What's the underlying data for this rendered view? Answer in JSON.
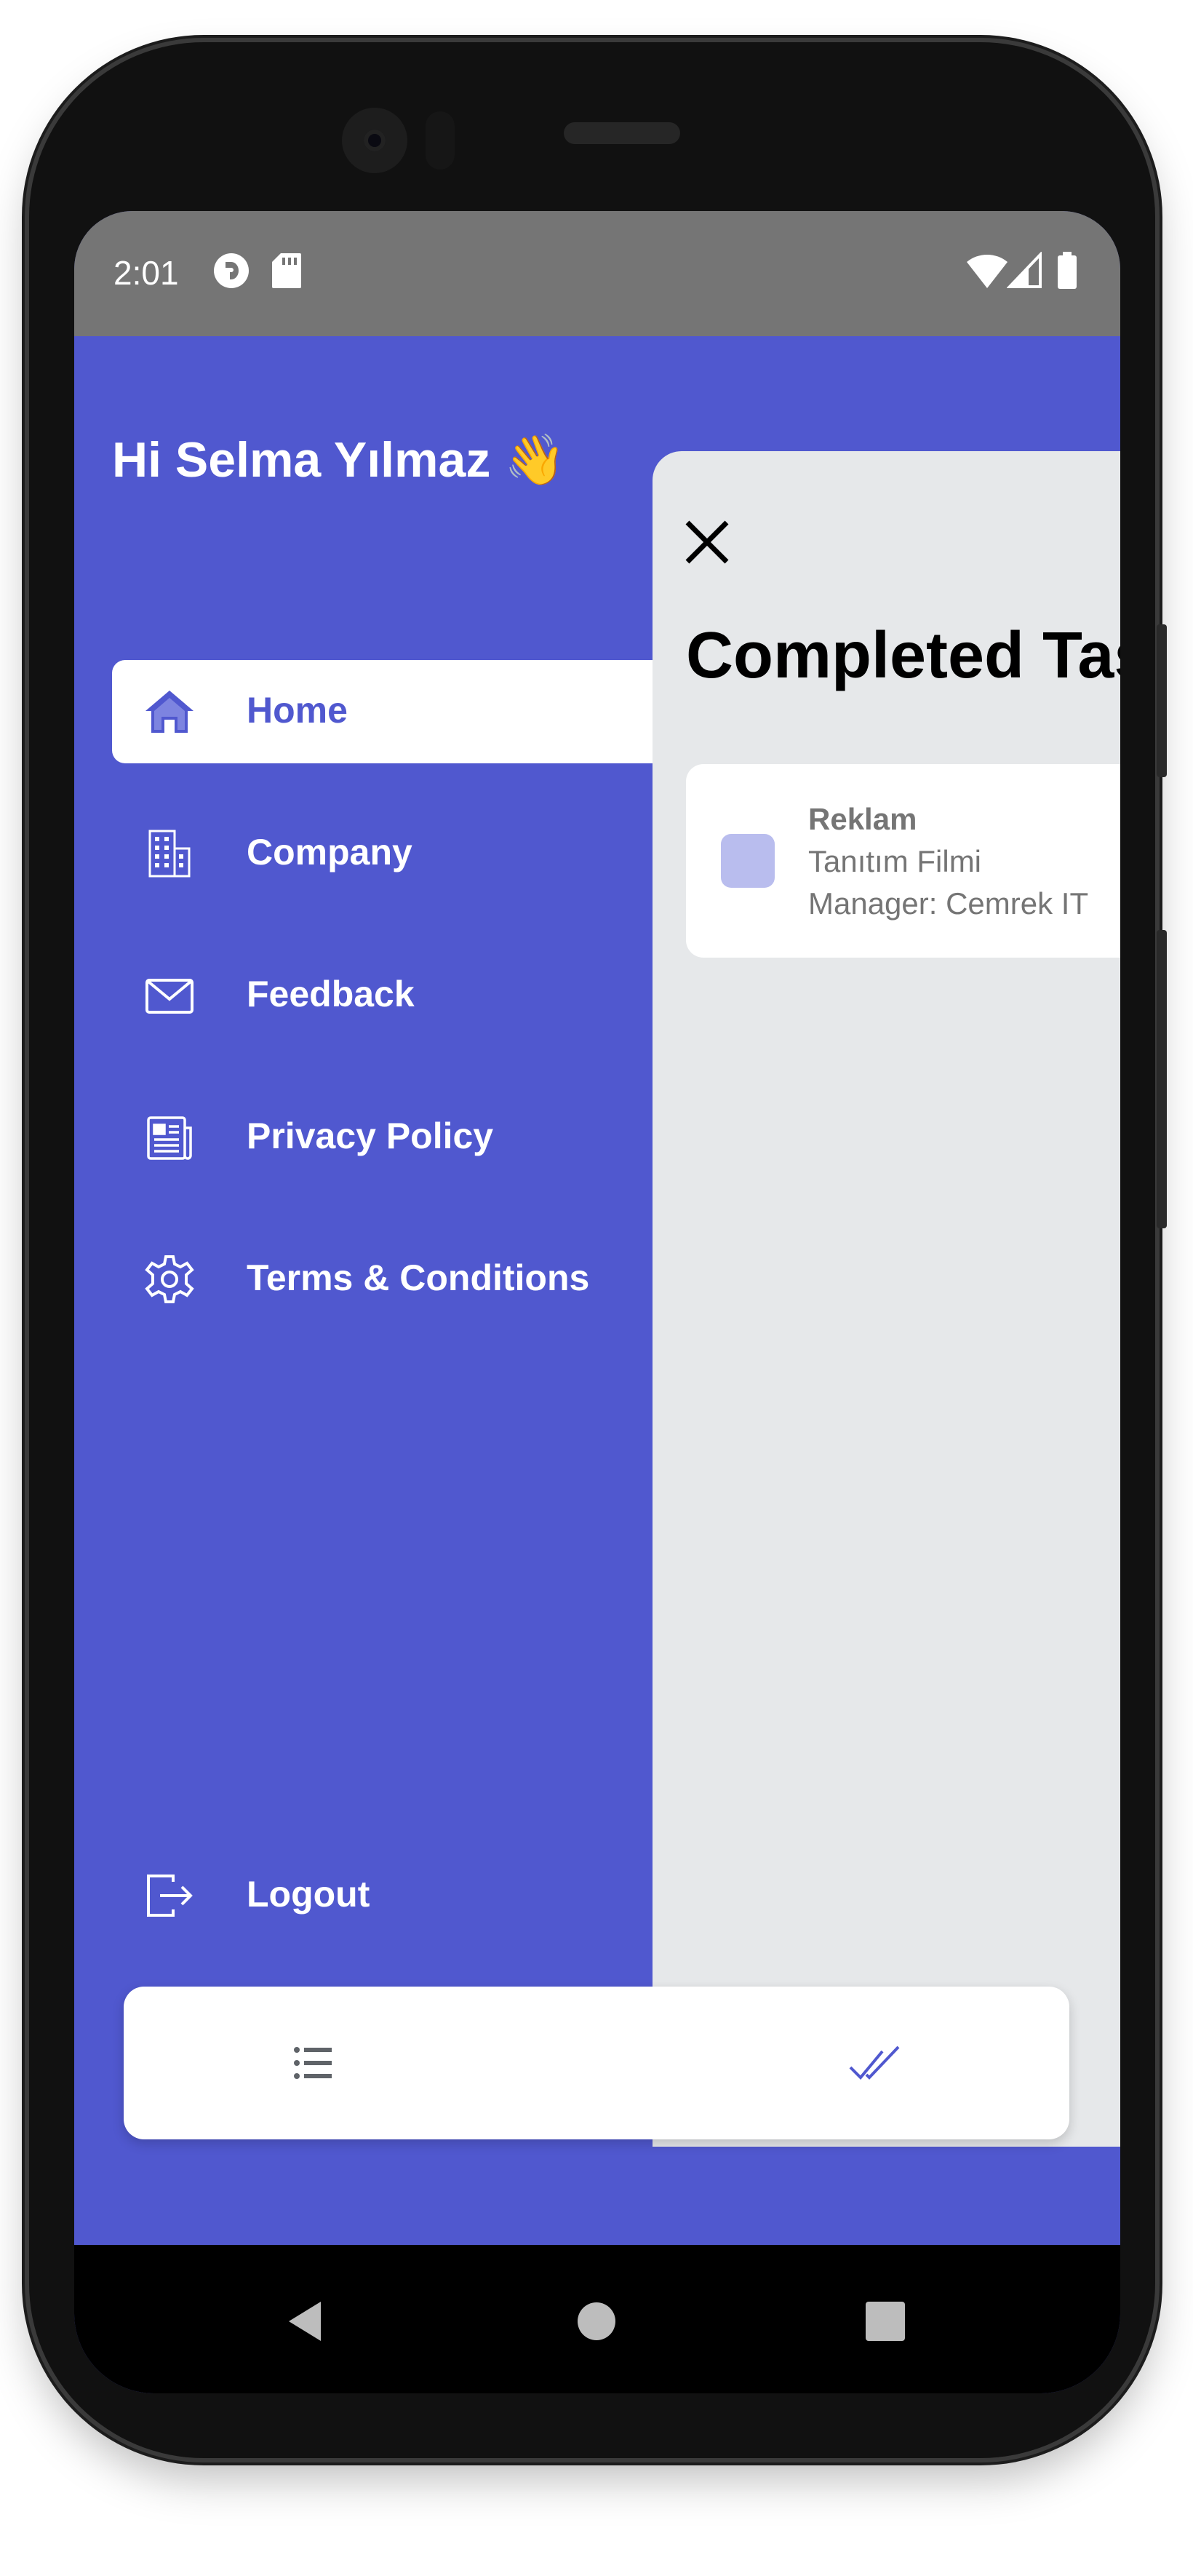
{
  "status_bar": {
    "time": "2:01"
  },
  "drawer": {
    "greeting": "Hi Selma Yılmaz 👋",
    "items": [
      {
        "label": "Home",
        "icon": "home-icon",
        "active": true
      },
      {
        "label": "Company",
        "icon": "building-icon",
        "active": false
      },
      {
        "label": "Feedback",
        "icon": "mail-icon",
        "active": false
      },
      {
        "label": "Privacy Policy",
        "icon": "newspaper-icon",
        "active": false
      },
      {
        "label": "Terms & Conditions",
        "icon": "gear-icon",
        "active": false
      }
    ],
    "logout_label": "Logout"
  },
  "panel": {
    "title": "Completed Tas",
    "tasks": [
      {
        "title": "Reklam",
        "subtitle": "Tanıtım Filmi",
        "manager": "Manager: Cemrek IT"
      }
    ]
  },
  "bottom_nav": {
    "items": [
      {
        "icon": "list-icon",
        "active": false
      },
      {
        "icon": "double-check-icon",
        "active": true
      }
    ]
  },
  "colors": {
    "accent": "#5058cf",
    "panel_bg": "#e6e8ea",
    "status_bar": "#757575",
    "task_swatch": "#b9bdee"
  }
}
